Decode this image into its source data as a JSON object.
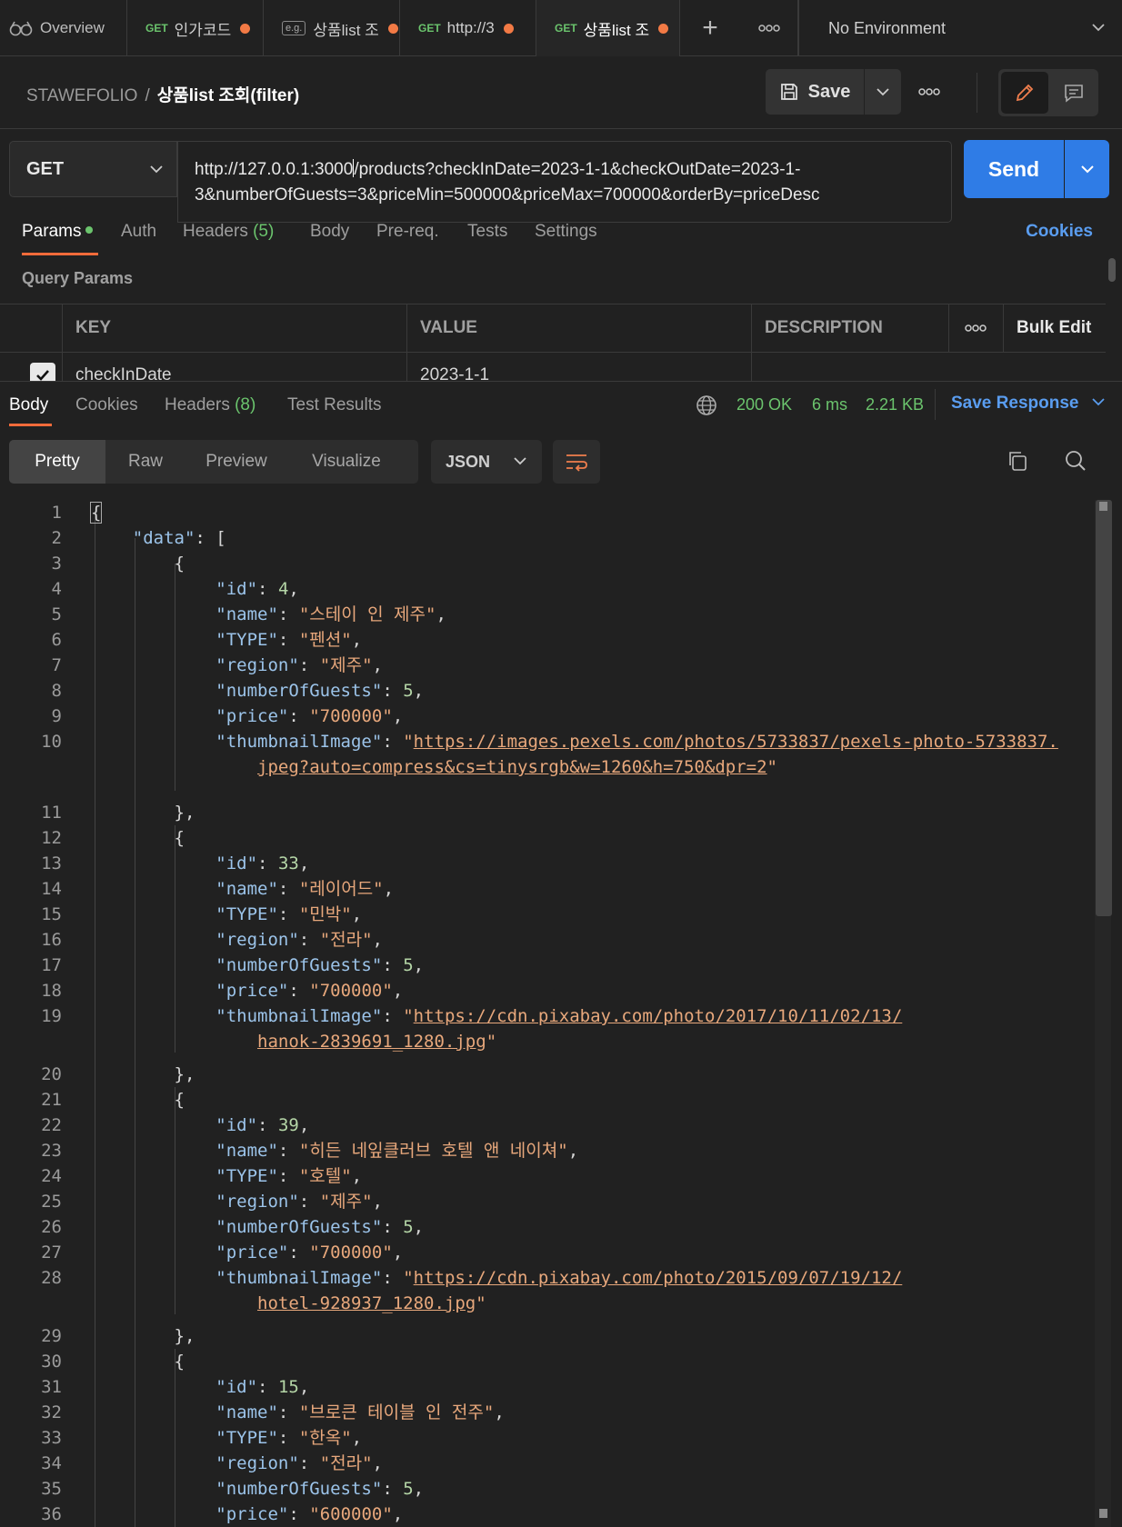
{
  "tabs": [
    {
      "label": "Overview",
      "method": "",
      "dot": false
    },
    {
      "label": "인가코드",
      "method": "GET",
      "dot": true
    },
    {
      "label": "상품list 조",
      "method": "",
      "dot": true
    },
    {
      "label": "http://3",
      "method": "GET",
      "dot": true
    },
    {
      "label": "상품list 조",
      "method": "GET",
      "dot": true
    }
  ],
  "environment": "No Environment",
  "breadcrumb": {
    "workspace": "STAWEFOLIO",
    "separator": "/",
    "request": "상품list 조회(filter)"
  },
  "header": {
    "save_label": "Save"
  },
  "request": {
    "method": "GET",
    "url_a": "http://127.0.0.1:3000",
    "url_b": "/products?checkInDate=2023-1-1&checkOutDate=2023-1-",
    "url_c": "3&numberOfGuests=3&priceMin=500000&priceMax=700000&orderBy=priceDesc",
    "send_label": "Send"
  },
  "request_tabs": {
    "params": "Params",
    "auth": "Auth",
    "headers": "Headers",
    "headers_count": "(5)",
    "body": "Body",
    "prereq": "Pre-req.",
    "tests": "Tests",
    "settings": "Settings",
    "cookies": "Cookies"
  },
  "query_params": {
    "title": "Query Params",
    "columns": {
      "key": "KEY",
      "value": "VALUE",
      "description": "DESCRIPTION",
      "bulk_edit": "Bulk Edit"
    },
    "rows": [
      {
        "key": "checkInDate",
        "value": "2023-1-1",
        "checked": true
      }
    ]
  },
  "response": {
    "tabs": {
      "body": "Body",
      "cookies": "Cookies",
      "headers": "Headers",
      "headers_count": "(8)",
      "tests": "Test Results"
    },
    "status": "200 OK",
    "time": "6 ms",
    "size": "2.21 KB",
    "save_response": "Save Response",
    "views": {
      "pretty": "Pretty",
      "raw": "Raw",
      "preview": "Preview",
      "visualize": "Visualize"
    },
    "format": "JSON"
  },
  "json_keys": {
    "data": "\"data\"",
    "id": "\"id\"",
    "name": "\"name\"",
    "type": "\"TYPE\"",
    "region": "\"region\"",
    "guests": "\"numberOfGuests\"",
    "price": "\"price\"",
    "thumb": "\"thumbnailImage\""
  },
  "code": {
    "line_numbers": [
      "1",
      "2",
      "3",
      "4",
      "5",
      "6",
      "7",
      "8",
      "9",
      "10",
      "11",
      "12",
      "13",
      "14",
      "15",
      "16",
      "17",
      "18",
      "19",
      "20",
      "21",
      "22",
      "23",
      "24",
      "25",
      "26",
      "27",
      "28",
      "29",
      "30",
      "31",
      "32",
      "33",
      "34",
      "35",
      "36"
    ],
    "products": [
      {
        "id": "4",
        "name": "\"스테이 인 제주\"",
        "type": "\"펜션\"",
        "region": "\"제주\"",
        "guests": "5",
        "price": "\"700000\"",
        "thumb1": "https://images.pexels.com/photos/5733837/pexels-photo-5733837.",
        "thumb2": "jpeg?auto=compress&cs=tinysrgb&w=1260&h=750&dpr=2"
      },
      {
        "id": "33",
        "name": "\"레이어드\"",
        "type": "\"민박\"",
        "region": "\"전라\"",
        "guests": "5",
        "price": "\"700000\"",
        "thumb1": "https://cdn.pixabay.com/photo/2017/10/11/02/13/",
        "thumb2": "hanok-2839691_1280.jpg"
      },
      {
        "id": "39",
        "name": "\"히든 네잎클러브 호텔 앤 네이쳐\"",
        "type": "\"호텔\"",
        "region": "\"제주\"",
        "guests": "5",
        "price": "\"700000\"",
        "thumb1": "https://cdn.pixabay.com/photo/2015/09/07/19/12/",
        "thumb2": "hotel-928937_1280.jpg"
      },
      {
        "id": "15",
        "name": "\"브로큰 테이블 인 전주\"",
        "type": "\"한옥\"",
        "region": "\"전라\"",
        "guests": "5",
        "price": "\"600000\""
      }
    ]
  }
}
